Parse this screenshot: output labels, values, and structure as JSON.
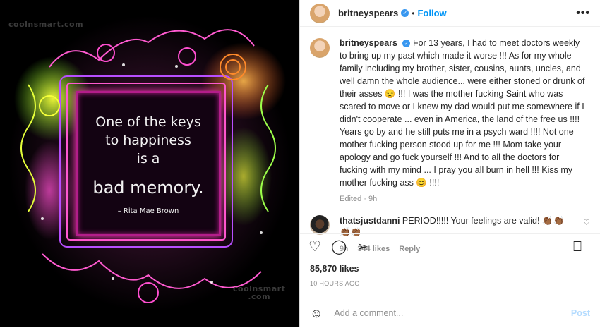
{
  "media": {
    "watermark_top": "coolnsmart.com",
    "watermark_bottom_1": "coolnsmart",
    "watermark_bottom_2": ".com",
    "quote_line1": "One of the keys",
    "quote_line2": "to happiness",
    "quote_line3": "is a",
    "quote_line4": "bad memory.",
    "quote_author": "– Rita Mae Brown"
  },
  "header": {
    "username": "britneyspears",
    "verified_icon": "✓",
    "separator": "•",
    "follow_label": "Follow",
    "more_icon": "•••"
  },
  "caption": {
    "username": "britneyspears",
    "verified_icon": "✓",
    "text": "For 13 years, I had to meet doctors weekly to bring up my past which made it worse !!! As for my whole family including my brother, sister, cousins, aunts, uncles, and well damn the whole audience... were either stoned or drunk of their asses 😒 !!! I was the mother fucking Saint who was scared to move or I knew my dad would put me somewhere if I didn't cooperate ... even in America, the land of the free us !!!! Years go by and he still puts me in a psych ward !!!! Not one mother fucking person stood up for me !!! Mom take your apology and go fuck yourself !!! And to all the doctors for fucking with my mind ... I pray you all burn in hell !!! Kiss my mother fucking ass 😊 !!!!",
    "meta": "Edited · 9h"
  },
  "comment": {
    "username": "thatsjustdanni",
    "text": "PERIOD!!!!! Your feelings are valid! 👏🏾👏🏾👏🏾👏🏾",
    "time": "9h",
    "likes": "344 likes",
    "reply": "Reply",
    "heart_icon": "♡"
  },
  "actions": {
    "like_icon": "♡",
    "comment_icon": "◯",
    "share_icon": "➢",
    "save_icon": "⎕"
  },
  "likes": "85,870 likes",
  "timestamp": "10 HOURS AGO",
  "add_comment": {
    "emoji_icon": "☺",
    "placeholder": "Add a comment...",
    "post_label": "Post"
  }
}
